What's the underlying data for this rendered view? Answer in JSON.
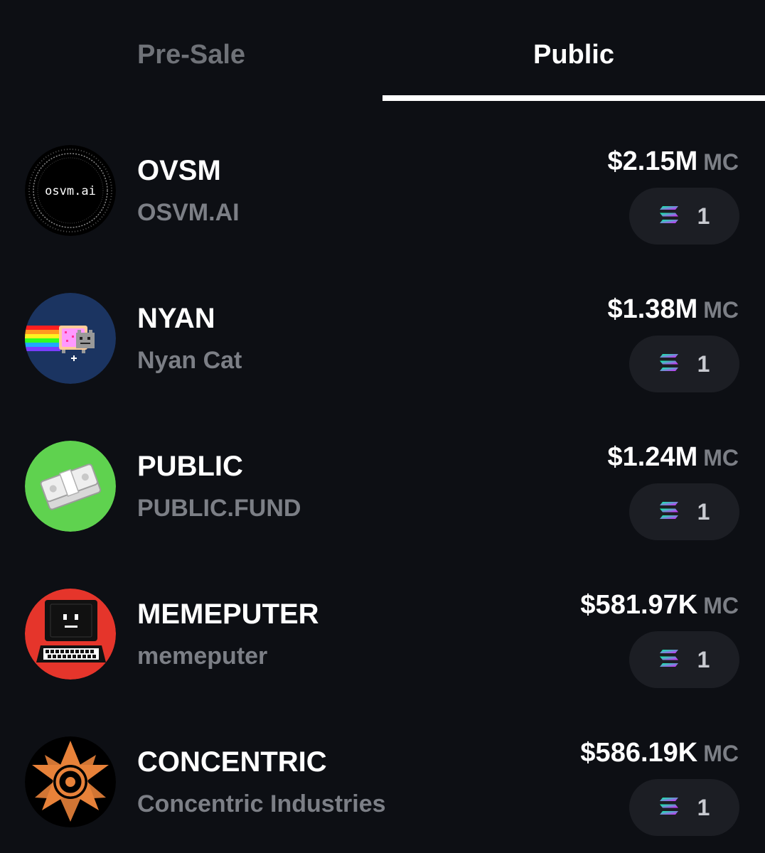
{
  "tabs": {
    "presale_label": "Pre-Sale",
    "public_label": "Public",
    "active": "public"
  },
  "tokens": [
    {
      "symbol": "OVSM",
      "name": "OSVM.AI",
      "market_cap": "$2.15M",
      "mc_label": "MC",
      "chain_count": "1",
      "avatar_text": "osvm.ai",
      "avatar_icon": "osvm-logo"
    },
    {
      "symbol": "NYAN",
      "name": "Nyan Cat",
      "market_cap": "$1.38M",
      "mc_label": "MC",
      "chain_count": "1",
      "avatar_icon": "nyan-cat-logo"
    },
    {
      "symbol": "PUBLIC",
      "name": "PUBLIC.FUND",
      "market_cap": "$1.24M",
      "mc_label": "MC",
      "chain_count": "1",
      "avatar_icon": "money-stack-logo"
    },
    {
      "symbol": "MEMEPUTER",
      "name": "memeputer",
      "market_cap": "$581.97K",
      "mc_label": "MC",
      "chain_count": "1",
      "avatar_icon": "computer-logo"
    },
    {
      "symbol": "CONCENTRIC",
      "name": "Concentric Industries",
      "market_cap": "$586.19K",
      "mc_label": "MC",
      "chain_count": "1",
      "avatar_icon": "star-emblem-logo"
    }
  ],
  "colors": {
    "background": "#0d0f14",
    "pill_background": "#1c1e24",
    "muted_text": "#7c7f86",
    "nyan_background": "#1b3461",
    "public_background": "#5fd24f",
    "memeputer_background": "#e5352b",
    "concentric_orange": "#e8823a"
  },
  "chain_icon": "solana-icon"
}
